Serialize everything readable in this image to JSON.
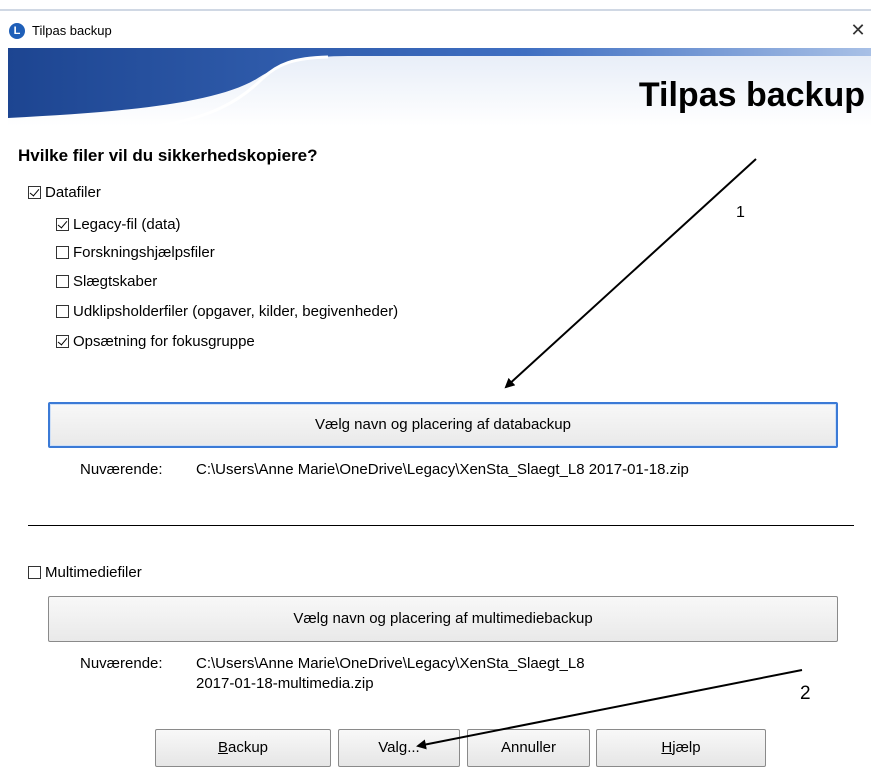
{
  "window": {
    "title": "Tilpas backup",
    "close_glyph": "✕",
    "app_icon_letter": "L"
  },
  "banner": {
    "title": "Tilpas backup"
  },
  "question": "Hvilke filer vil du sikkerhedskopiere?",
  "datafiles": {
    "label": "Datafiler",
    "checked": true,
    "items": [
      {
        "label": "Legacy-fil (data)",
        "checked": true
      },
      {
        "label": "Forskningshjælpsfiler",
        "checked": false
      },
      {
        "label": "Slægtskaber",
        "checked": false
      },
      {
        "label": "Udklipsholderfiler (opgaver, kilder, begivenheder)",
        "checked": false
      },
      {
        "label": "Opsætning for fokusgruppe",
        "checked": true
      }
    ],
    "choose_button": "Vælg navn og placering af databackup",
    "current_label": "Nuværende:",
    "current_path": "C:\\Users\\Anne Marie\\OneDrive\\Legacy\\XenSta_Slaegt_L8 2017-01-18.zip"
  },
  "multimedia": {
    "label": "Multimediefiler",
    "checked": false,
    "choose_button": "Vælg navn og placering af multimediebackup",
    "current_label": "Nuværende:",
    "current_path_line1": "C:\\Users\\Anne Marie\\OneDrive\\Legacy\\XenSta_Slaegt_L8",
    "current_path_line2": "2017-01-18-multimedia.zip"
  },
  "buttons": {
    "backup": {
      "accel": "B",
      "rest": "ackup"
    },
    "options": "Valg...",
    "cancel": "Annuller",
    "help": {
      "accel": "H",
      "rest": "jælp"
    }
  },
  "annotations": {
    "label1": "1",
    "label2": "2"
  },
  "colors": {
    "banner_blue": "#2d5aa8",
    "focus_border": "#3b7ad6"
  }
}
